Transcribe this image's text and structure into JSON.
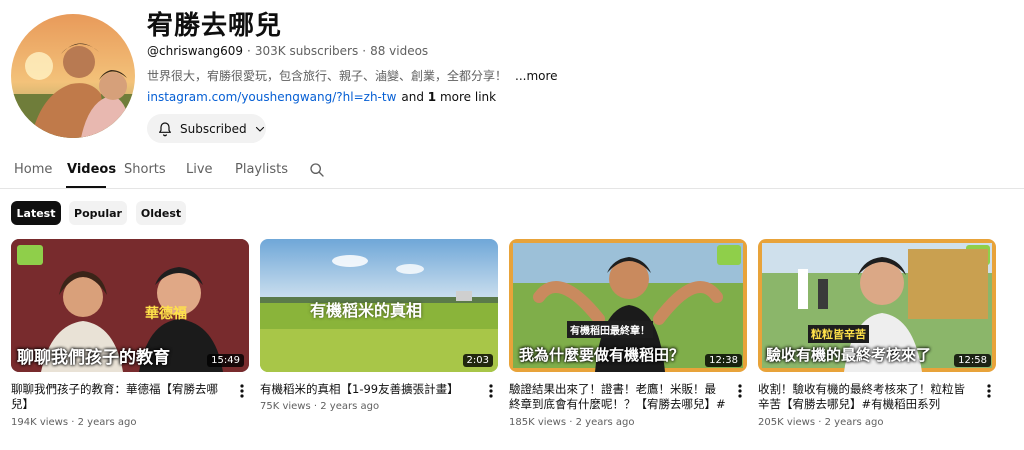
{
  "channel": {
    "name": "宥勝去哪兒",
    "handle": "@chriswang609",
    "subscribers": "303K subscribers",
    "videos_count": "88 videos",
    "description": "世界很大，宥勝很愛玩，包含旅行、親子、滷變、創業，全都分享！",
    "more_label": "...more",
    "link_text": "instagram.com/youshengwang/?hl=zh-tw",
    "more_links_prefix": "and ",
    "more_links_count": "1",
    "more_links_suffix": " more link",
    "subscribe_label": "Subscribed"
  },
  "tabs": [
    {
      "label": "Home"
    },
    {
      "label": "Videos"
    },
    {
      "label": "Shorts"
    },
    {
      "label": "Live"
    },
    {
      "label": "Playlists"
    }
  ],
  "chips": [
    {
      "label": "Latest"
    },
    {
      "label": "Popular"
    },
    {
      "label": "Oldest"
    }
  ],
  "videos": [
    {
      "title": "聊聊我們孩子的教育：華德福【宥勝去哪兒】",
      "views": "194K views",
      "age": "2 years ago",
      "duration": "15:49",
      "thumb_text": "聊聊我們孩子的教育",
      "thumb_tag": "華德福"
    },
    {
      "title": "有機稻米的真相【1-99友善擴張計畫】",
      "views": "75K views",
      "age": "2 years ago",
      "duration": "2:03",
      "thumb_text": "有機稻米的真相"
    },
    {
      "title": "驗證結果出來了！證書！老鷹！米販！最終章到底會有什麼呢！？【宥勝去哪兒】#有...",
      "views": "185K views",
      "age": "2 years ago",
      "duration": "12:38",
      "thumb_text": "我為什麼要做有機稻田？",
      "thumb_tag": "有機稻田最終章！"
    },
    {
      "title": "收割！驗收有機的最終考核來了！粒粒皆辛苦【宥勝去哪兒】#有機稻田系列",
      "views": "205K views",
      "age": "2 years ago",
      "duration": "12:58",
      "thumb_text": "驗收有機的最終考核來了",
      "thumb_tag": "粒粒皆辛苦"
    }
  ],
  "icons": {
    "bell": "bell-icon",
    "chevron": "chevron-down-icon",
    "search": "search-icon",
    "kebab": "more-vert-icon"
  },
  "colors": {
    "link": "#065fd4",
    "text": "#0f0f0f",
    "secondary": "#606060",
    "chip_active_bg": "#0f0f0f",
    "chip_bg": "#f2f2f2"
  }
}
